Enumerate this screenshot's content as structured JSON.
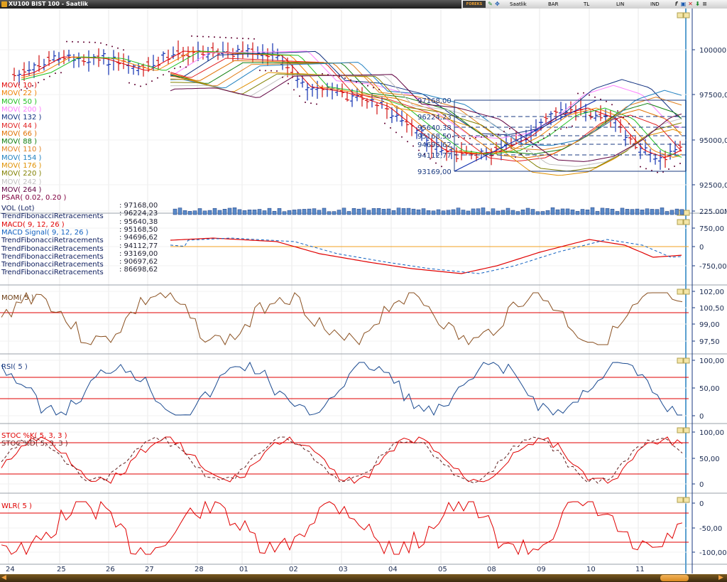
{
  "window": {
    "title": "XU100 BIST 100 - Saatlik"
  },
  "toolbar": {
    "brand": "FOREKS",
    "period": "Saatlik",
    "type": "BAR",
    "tl": "TL",
    "lin": "LIN",
    "ind": "IND"
  },
  "price_axis": [
    "100000,00",
    "97500,00",
    "95000,00",
    "92500,00"
  ],
  "volume_axis": [
    "225.00M"
  ],
  "macd_axis": [
    "750,00",
    "0",
    "-750,00"
  ],
  "mom_axis": [
    "102,00",
    "100,50",
    "99,00",
    "97,50"
  ],
  "rsi_axis": [
    "100,00",
    "50,00",
    "0"
  ],
  "stoc_axis": [
    "100,00",
    "50,00",
    "0"
  ],
  "wlr_axis": [
    "0",
    "-50,00",
    "-100,00"
  ],
  "date_axis": [
    "24",
    "25",
    "26",
    "27",
    "28",
    "01",
    "02",
    "03",
    "04",
    "05",
    "08",
    "09",
    "10",
    "11"
  ],
  "fib_levels": [
    "97168,00",
    "96224,23",
    "95640,38",
    "95168,50",
    "94696,62",
    "94112,77",
    "93169,00"
  ],
  "legend_main": [
    {
      "label": "MOV( 10 )",
      "color": "#e00000"
    },
    {
      "label": "MOV( 22 )",
      "color": "#f08000"
    },
    {
      "label": "MOV( 50 )",
      "color": "#20c020"
    },
    {
      "label": "MOV( 200 )",
      "color": "#ff80ff"
    },
    {
      "label": "MOV( 132 )",
      "color": "#103080"
    },
    {
      "label": "MOV( 44 )",
      "color": "#e02020"
    },
    {
      "label": "MOV( 66 )",
      "color": "#e07000"
    },
    {
      "label": "MOV( 88 )",
      "color": "#108010"
    },
    {
      "label": "MOV( 110 )",
      "color": "#e08020"
    },
    {
      "label": "MOV( 154 )",
      "color": "#2080c0"
    },
    {
      "label": "MOV( 176 )",
      "color": "#e09000"
    },
    {
      "label": "MOV( 220 )",
      "color": "#808000"
    },
    {
      "label": "MOV( 242 )",
      "color": "#c0c0c0"
    },
    {
      "label": "MOV( 264 )",
      "color": "#600040"
    },
    {
      "label": "PSAR( 0.02, 0.20 )",
      "color": "#800040"
    }
  ],
  "legend_sub": [
    {
      "label": "VOL (Lot)",
      "color": "#102060"
    },
    {
      "label": "TrendFibonacciRetracements",
      "color": "#102060"
    },
    {
      "label": "MACD( 9, 12, 26 )",
      "color": "#e00000"
    },
    {
      "label": "MACD Signal( 9, 12, 26 )",
      "color": "#1060c0"
    },
    {
      "label": "TrendFibonacciRetracements",
      "color": "#102060"
    },
    {
      "label": "TrendFibonacciRetracements",
      "color": "#102060"
    },
    {
      "label": "TrendFibonacciRetracements",
      "color": "#102060"
    },
    {
      "label": "TrendFibonacciRetracements",
      "color": "#102060"
    },
    {
      "label": "TrendFibonacciRetracements",
      "color": "#102060"
    }
  ],
  "legend_values": [
    ": 97168,00",
    ": 96224,23",
    ": 95640,38",
    ": 95168,50",
    ": 94696,62",
    ": 94112,77",
    ": 93169,00",
    ": 90697,62",
    ": 86698,62"
  ],
  "panel_labels": {
    "mom": "MOM( 5 )",
    "rsi": "RSI( 5 )",
    "stock": "STOC %K( 5, 3, 3 )",
    "stocd": "STOC %D( 5, 3, 3 )",
    "wlr": "WLR( 5 )"
  },
  "colors": {
    "candle": "#1030b0",
    "fib": "#1a3a80",
    "ref_line": "#e00000",
    "mom_line": "#8a5020",
    "rsi_line": "#1a4a90",
    "stoc_d": "#602020",
    "axis_bg": "#ffffff",
    "vline": "#5aa0d0"
  }
}
